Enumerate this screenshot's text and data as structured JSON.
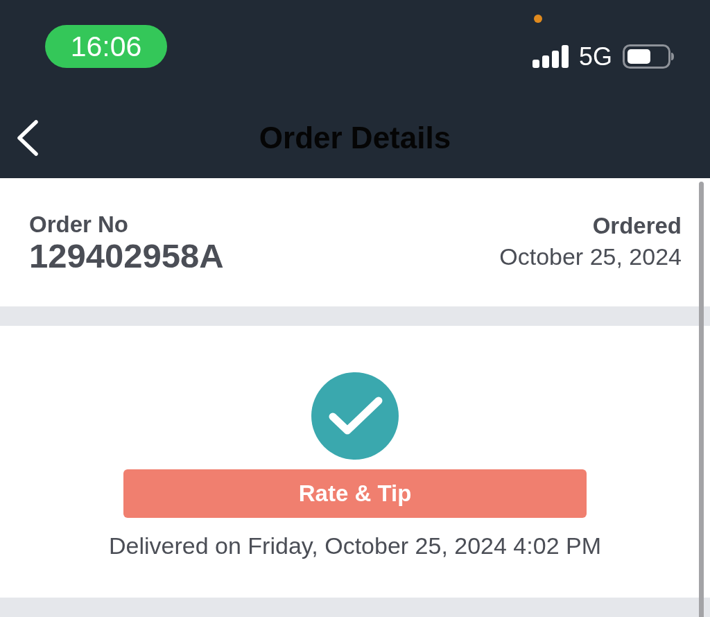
{
  "status_bar": {
    "time": "16:06",
    "network": "5G",
    "privacy_indicator": true
  },
  "nav_bar": {
    "title": "Order Details"
  },
  "order_summary": {
    "number_label": "Order No",
    "number": "129402958A",
    "date_label": "Ordered",
    "date": "October 25, 2024"
  },
  "delivery": {
    "completed": true,
    "button": "Rate & Tip",
    "message": "Delivered on Friday, October 25, 2024 4:02 PM"
  }
}
